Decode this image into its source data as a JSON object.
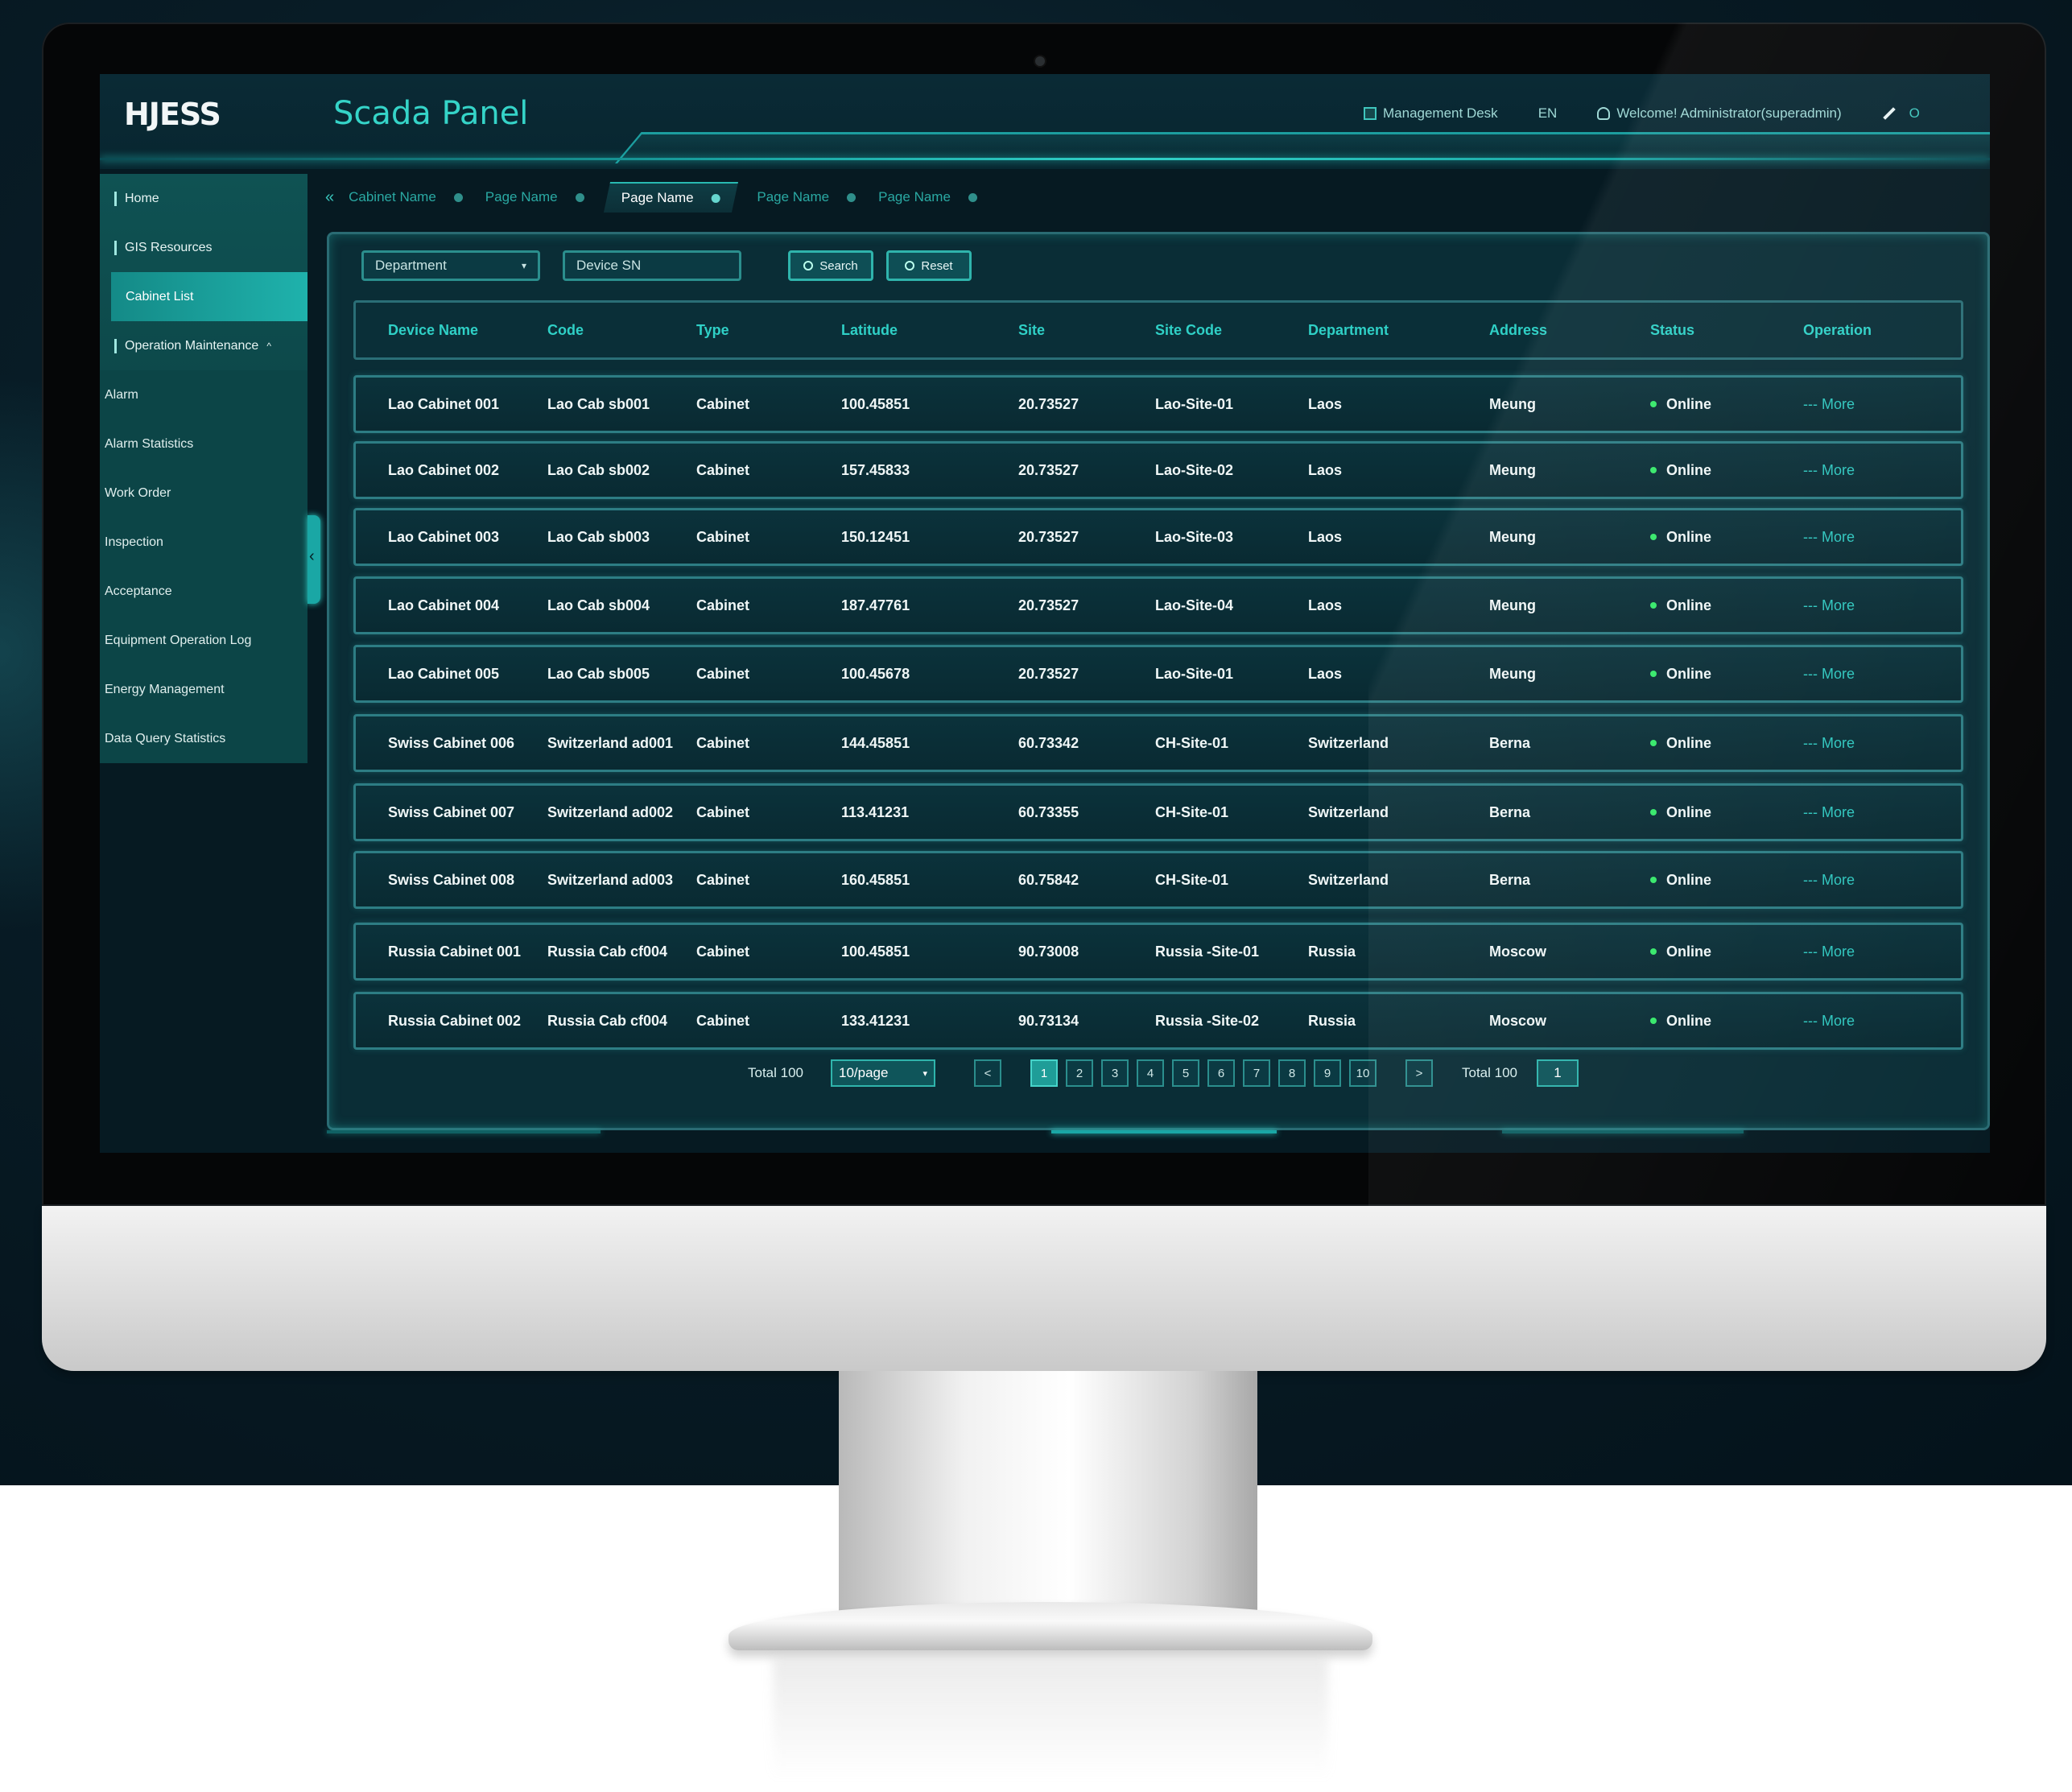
{
  "header": {
    "logo": "HJESS",
    "title": "Scada Panel",
    "management_desk": "Management Desk",
    "language": "EN",
    "welcome": "Welcome! Administrator(superadmin)",
    "trailing": "O"
  },
  "sidebar": {
    "home": "Home",
    "gis": "GIS Resources",
    "cabinet_list": "Cabinet List",
    "operation": "Operation Maintenance",
    "sub": [
      "Alarm",
      "Alarm Statistics",
      "Work Order",
      "Inspection",
      "Acceptance",
      "Equipment Operation Log",
      "Energy Management",
      "Data Query Statistics"
    ]
  },
  "tabs": [
    "Cabinet Name",
    "Page Name",
    "Page Name",
    "Page Name",
    "Page Name"
  ],
  "filters": {
    "department": "Department",
    "device_sn": "Device SN",
    "search": "Search",
    "reset": "Reset"
  },
  "table": {
    "columns": [
      "Device Name",
      "Code",
      "Type",
      "Latitude",
      "Site",
      "Site Code",
      "Department",
      "Address",
      "Status",
      "Operation"
    ],
    "rows": [
      [
        "Lao Cabinet 001",
        "Lao Cab sb001",
        "Cabinet",
        "100.45851",
        "20.73527",
        "Lao-Site-01",
        "Laos",
        "Meung",
        "Online",
        "--- More"
      ],
      [
        "Lao Cabinet 002",
        "Lao Cab sb002",
        "Cabinet",
        "157.45833",
        "20.73527",
        "Lao-Site-02",
        "Laos",
        "Meung",
        "Online",
        "--- More"
      ],
      [
        "Lao Cabinet 003",
        "Lao Cab sb003",
        "Cabinet",
        "150.12451",
        "20.73527",
        "Lao-Site-03",
        "Laos",
        "Meung",
        "Online",
        "--- More"
      ],
      [
        "Lao Cabinet 004",
        "Lao Cab sb004",
        "Cabinet",
        "187.47761",
        "20.73527",
        "Lao-Site-04",
        "Laos",
        "Meung",
        "Online",
        "--- More"
      ],
      [
        "Lao Cabinet 005",
        "Lao Cab sb005",
        "Cabinet",
        "100.45678",
        "20.73527",
        "Lao-Site-01",
        "Laos",
        "Meung",
        "Online",
        "--- More"
      ],
      [
        "Swiss Cabinet 006",
        "Switzerland ad001",
        "Cabinet",
        "144.45851",
        "60.73342",
        "CH-Site-01",
        "Switzerland",
        "Berna",
        "Online",
        "--- More"
      ],
      [
        "Swiss Cabinet 007",
        "Switzerland ad002",
        "Cabinet",
        "113.41231",
        "60.73355",
        "CH-Site-01",
        "Switzerland",
        "Berna",
        "Online",
        "--- More"
      ],
      [
        "Swiss Cabinet 008",
        "Switzerland ad003",
        "Cabinet",
        "160.45851",
        "60.75842",
        "CH-Site-01",
        "Switzerland",
        "Berna",
        "Online",
        "--- More"
      ],
      [
        "Russia Cabinet 001",
        "Russia  Cab cf004",
        "Cabinet",
        "100.45851",
        "90.73008",
        "Russia -Site-01",
        "Russia",
        "Moscow",
        "Online",
        "--- More"
      ],
      [
        "Russia  Cabinet 002",
        "Russia Cab cf004",
        "Cabinet",
        "133.41231",
        "90.73134",
        "Russia -Site-02",
        "Russia",
        "Moscow",
        "Online",
        "--- More"
      ]
    ]
  },
  "pagination": {
    "total_left": "Total 100",
    "page_size": "10/page",
    "prev": "<",
    "pages": [
      "1",
      "2",
      "3",
      "4",
      "5",
      "6",
      "7",
      "8",
      "9",
      "10"
    ],
    "next": ">",
    "total_right": "Total 100",
    "jump": "1"
  },
  "colors": {
    "accent": "#2fd0c6",
    "status_online": "#35e86a",
    "background": "#061a22"
  }
}
